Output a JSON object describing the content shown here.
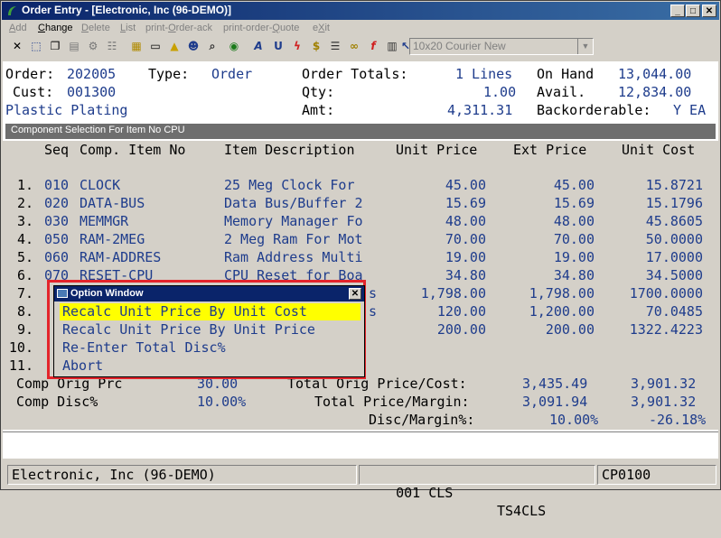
{
  "window": {
    "title": "Order Entry - [Electronic, Inc (96-DEMO)]",
    "min": "_",
    "max": "□",
    "close": "✕"
  },
  "menu": [
    "Add",
    "Change",
    "Delete",
    "List",
    "print-Order-ack",
    "print-order-Quote",
    "eXit"
  ],
  "toolbar": {
    "icons": [
      "close-icon",
      "select-icon",
      "copy-icon",
      "paste-icon",
      "settings-icon",
      "options-icon",
      "notes-icon",
      "document-icon",
      "bell-icon",
      "person-icon",
      "search-icon",
      "globe-icon",
      "font-icon",
      "unit-icon",
      "lightning-icon",
      "dollar-icon",
      "list-icon",
      "link-icon",
      "function-icon",
      "book-icon",
      "help-pointer-icon"
    ],
    "font_select": "10x20 Courier New"
  },
  "header": {
    "order_label": "Order:",
    "order_value": "202005",
    "type_label": "Type:",
    "type_value": "Order",
    "cust_label": "Cust:",
    "cust_value": "001300",
    "cust_name": "Plastic Plating",
    "totals_label": "Order Totals:",
    "lines": "1 Lines",
    "qty_label": "Qty:",
    "qty_value": "1.00",
    "amt_label": "Amt:",
    "amt_value": "4,311.31",
    "onhand_label": "On Hand",
    "onhand_value": "13,044.00",
    "avail_label": "Avail.",
    "avail_value": "12,834.00",
    "backorder_label": "Backorderable:",
    "backorder_value": "Y EA"
  },
  "section": {
    "title": "Component Selection For Item No CPU"
  },
  "table": {
    "columns": [
      "Seq",
      "Comp. Item No",
      "Item Description",
      "Unit Price",
      "Ext Price",
      "Unit Cost"
    ],
    "rows": [
      {
        "n": "1.",
        "seq": "010",
        "item": "CLOCK",
        "desc": "25 Meg Clock For",
        "unit": "45.00",
        "ext": "45.00",
        "cost": "15.8721"
      },
      {
        "n": "2.",
        "seq": "020",
        "item": "DATA-BUS",
        "desc": "Data Bus/Buffer 2",
        "unit": "15.69",
        "ext": "15.69",
        "cost": "15.1796"
      },
      {
        "n": "3.",
        "seq": "030",
        "item": "MEMMGR",
        "desc": "Memory Manager Fo",
        "unit": "48.00",
        "ext": "48.00",
        "cost": "45.8605"
      },
      {
        "n": "4.",
        "seq": "050",
        "item": "RAM-2MEG",
        "desc": "2 Meg Ram For Mot",
        "unit": "70.00",
        "ext": "70.00",
        "cost": "50.0000"
      },
      {
        "n": "5.",
        "seq": "060",
        "item": "RAM-ADDRES",
        "desc": "Ram Address Multi",
        "unit": "19.00",
        "ext": "19.00",
        "cost": "17.0000"
      },
      {
        "n": "6.",
        "seq": "070",
        "item": "RESET-CPU",
        "desc": "CPU Reset for Boa",
        "unit": "34.80",
        "ext": "34.80",
        "cost": "34.5000"
      },
      {
        "n": "7.",
        "seq": "",
        "item": "",
        "desc": "s",
        "unit": "1,798.00",
        "ext": "1,798.00",
        "cost": "1700.0000"
      },
      {
        "n": "8.",
        "seq": "",
        "item": "",
        "desc": "s",
        "unit": "120.00",
        "ext": "1,200.00",
        "cost": "70.0485"
      },
      {
        "n": "9.",
        "seq": "",
        "item": "",
        "desc": "",
        "unit": "200.00",
        "ext": "200.00",
        "cost": "1322.4223"
      },
      {
        "n": "10.",
        "seq": "",
        "item": "",
        "desc": "",
        "unit": "",
        "ext": "",
        "cost": ""
      },
      {
        "n": "11.",
        "seq": "",
        "item": "",
        "desc": "",
        "unit": "",
        "ext": "",
        "cost": ""
      }
    ]
  },
  "summary": {
    "comp_orig_label": "Comp Orig Prc",
    "comp_orig_value": "30.00",
    "total_orig_label": "Total Orig Price/Cost:",
    "total_orig_price": "3,435.49",
    "total_orig_cost": "3,901.32",
    "comp_disc_label": "Comp Disc%",
    "comp_disc_value": "10.00%",
    "total_price_label": "Total Price/Margin:",
    "total_price": "3,091.94",
    "total_margin": "3,901.32",
    "disc_margin_label": "Disc/Margin%:",
    "disc_pct": "10.00%",
    "margin_pct": "-26.18%"
  },
  "popup": {
    "title": "Option Window",
    "close": "✕",
    "options": [
      "Recalc Unit Price By Unit Cost",
      "Recalc Unit Price By Unit Price",
      "Re-Enter Total Disc%",
      "Abort"
    ],
    "selected_index": 0
  },
  "status": {
    "company": "Electronic, Inc (96-DEMO)",
    "loc": "001 CLS",
    "station": "TS4CLS",
    "printer": "CP0100"
  },
  "colors": {
    "highlight": "#ffff00",
    "frame": "#e3242b",
    "value_text": "#1e3c8c",
    "title_bar": "#0a246a"
  }
}
